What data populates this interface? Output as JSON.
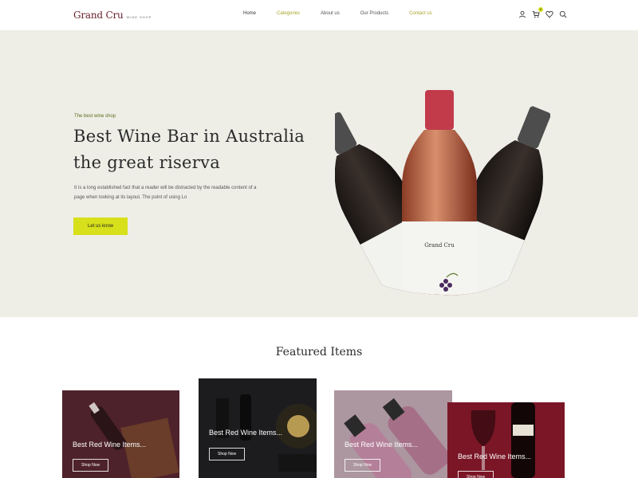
{
  "brand": {
    "name": "Grand Cru",
    "tagline": "WINE SHOP"
  },
  "nav": {
    "items": [
      {
        "label": "Home"
      },
      {
        "label": "Categories"
      },
      {
        "label": "About us"
      },
      {
        "label": "Our Products"
      },
      {
        "label": "Contact us"
      }
    ],
    "cart_count": "0"
  },
  "header_icons": [
    "user-icon",
    "cart-icon",
    "heart-icon",
    "search-icon"
  ],
  "hero": {
    "eyebrow": "The best wine shop",
    "title_line1": "Best Wine Bar in Australia",
    "title_line2": "the great riserva",
    "description_line1": "It is a long established fact that a reader will be distracted by the readable content of a",
    "description_line2": "page when looking at its layout. The point of using Lo",
    "cta_label": "Let us know",
    "bottle_label": "Grand Cru"
  },
  "featured": {
    "title": "Featured Items",
    "cards": [
      {
        "title": "Best Red Wine Items...",
        "button": "Shop Now"
      },
      {
        "title": "Best Red Wine Items...",
        "button": "Shop Now"
      },
      {
        "title": "Best Red Wine Items...",
        "button": "Shop Now"
      },
      {
        "title": "Best Red Wine Items...",
        "button": "Shop Now"
      }
    ]
  },
  "colors": {
    "accent": "#d7e01a",
    "brand": "#6b1f2a",
    "hero_bg": "#eeeee7"
  }
}
